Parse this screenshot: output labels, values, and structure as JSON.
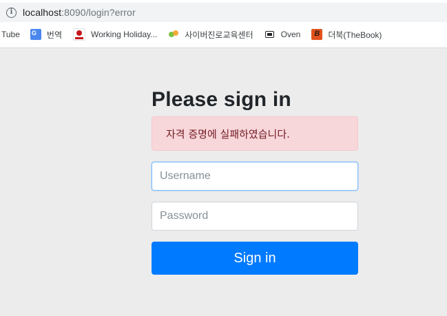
{
  "browser": {
    "url_host": "localhost",
    "url_rest": ":8090/login?error"
  },
  "bookmarks": [
    {
      "label": "Tube",
      "icon": "none"
    },
    {
      "label": "번역",
      "icon": "google-translate-icon"
    },
    {
      "label": "Working Holiday...",
      "icon": "working-holiday-icon"
    },
    {
      "label": "사이버진로교육센터",
      "icon": "cyber-career-icon"
    },
    {
      "label": "Oven",
      "icon": "oven-icon"
    },
    {
      "label": "더북(TheBook)",
      "icon": "thebook-icon"
    }
  ],
  "login": {
    "heading": "Please sign in",
    "error_message": "자격 증명에 실패하였습니다.",
    "username_placeholder": "Username",
    "password_placeholder": "Password",
    "submit_label": "Sign in"
  },
  "colors": {
    "primary": "#007bff",
    "alert_bg": "#f8d7da",
    "alert_text": "#721c24",
    "page_bg": "#ececec"
  }
}
